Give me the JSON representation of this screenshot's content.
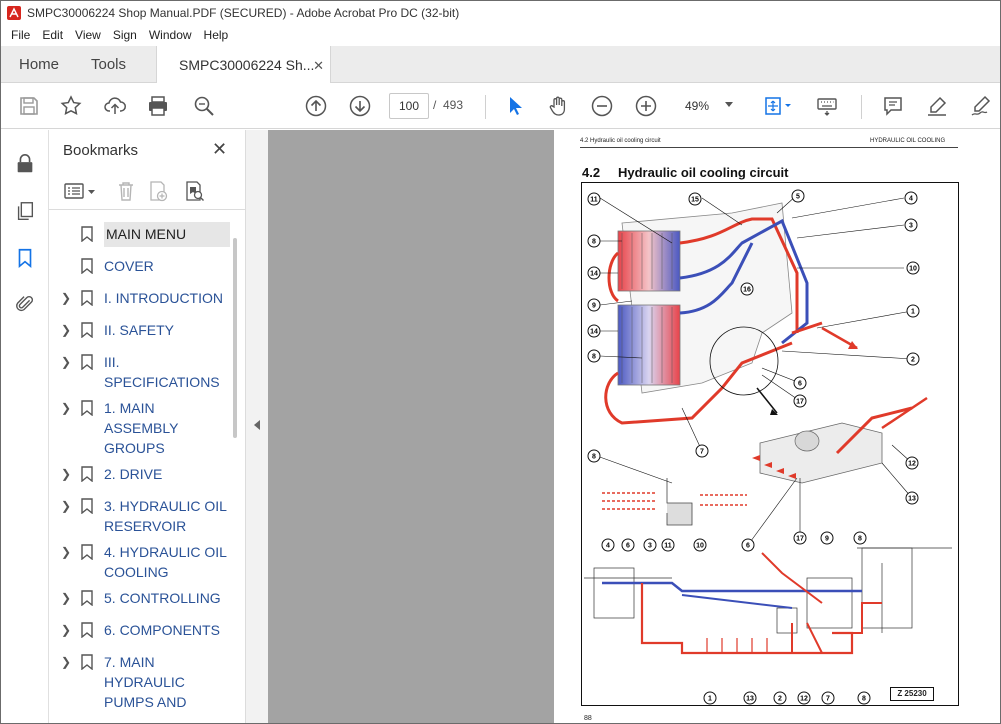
{
  "window": {
    "title": "SMPC30006224 Shop Manual.PDF (SECURED) - Adobe Acrobat Pro DC (32-bit)"
  },
  "menu": [
    "File",
    "Edit",
    "View",
    "Sign",
    "Window",
    "Help"
  ],
  "tabs": {
    "home": "Home",
    "tools": "Tools",
    "document": "SMPC30006224 Sh...",
    "close_glyph": "✕"
  },
  "toolbar": {
    "page_current": "100",
    "page_separator": "/",
    "page_total": "493",
    "zoom": "49%",
    "icons": [
      "save-icon",
      "bookmark-star-icon",
      "upload-icon",
      "print-icon",
      "search-zoom-icon",
      "page-up-icon",
      "page-down-icon",
      "select-cursor-icon",
      "hand-icon",
      "zoom-out-icon",
      "zoom-in-icon",
      "fit-page-icon",
      "keyboard-icon",
      "comment-icon",
      "highlight-pen-icon",
      "sign-icon"
    ]
  },
  "rail": {
    "icons": [
      "lock-icon",
      "pages-icon",
      "bookmark-icon",
      "attachment-icon"
    ]
  },
  "bookmarks": {
    "header": "Bookmarks",
    "close_glyph": "✕",
    "items": [
      {
        "label": "MAIN MENU",
        "expandable": false,
        "selected": true
      },
      {
        "label": "COVER",
        "expandable": false,
        "selected": false
      },
      {
        "label": "I. INTRODUCTION",
        "expandable": true,
        "selected": false
      },
      {
        "label": "II. SAFETY",
        "expandable": true,
        "selected": false
      },
      {
        "label": "III. SPECIFICATIONS",
        "expandable": true,
        "selected": false
      },
      {
        "label": "1. MAIN ASSEMBLY GROUPS",
        "expandable": true,
        "selected": false
      },
      {
        "label": "2. DRIVE",
        "expandable": true,
        "selected": false
      },
      {
        "label": "3. HYDRAULIC OIL RESERVOIR",
        "expandable": true,
        "selected": false
      },
      {
        "label": "4. HYDRAULIC OIL COOLING",
        "expandable": true,
        "selected": false
      },
      {
        "label": "5. CONTROLLING",
        "expandable": true,
        "selected": false
      },
      {
        "label": "6. COMPONENTS",
        "expandable": true,
        "selected": false
      },
      {
        "label": "7. MAIN HYDRAULIC PUMPS AND",
        "expandable": true,
        "selected": false
      }
    ]
  },
  "page": {
    "header_left": "4.2 Hydraulic oil cooling circuit",
    "header_right": "HYDRAULIC OIL COOLING",
    "section_number": "4.2",
    "section_title": "Hydraulic oil cooling circuit",
    "figure_ref": "Z 25230",
    "page_number": "88",
    "callouts_top": [
      "11",
      "15",
      "5",
      "4",
      "3",
      "10",
      "8",
      "14",
      "16",
      "9",
      "1",
      "14",
      "8",
      "2",
      "6",
      "17",
      "7",
      "8",
      "12",
      "13"
    ],
    "callouts_bottom_top": [
      "4",
      "6",
      "3",
      "11",
      "10",
      "6",
      "17",
      "9",
      "8"
    ],
    "callouts_bottom_bottom": [
      "1",
      "13",
      "2",
      "12",
      "7",
      "8"
    ]
  },
  "colors": {
    "accent_blue": "#1473e6",
    "hot_red": "#e03a2a",
    "cool_blue": "#3b4fb8"
  }
}
